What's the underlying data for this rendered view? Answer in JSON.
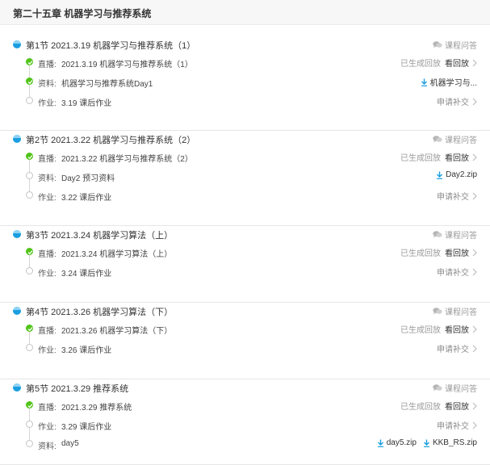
{
  "chapter_title": "第二十五章 机器学习与推荐系统",
  "colors": {
    "accent": "#1a9ee0",
    "done": "#52c41a",
    "pending": "#c4c4c4"
  },
  "icons": {
    "section": "half-filled-circle-icon",
    "qa": "chat-bubble-icon",
    "done": "check-circle-icon",
    "pending": "hollow-circle-icon",
    "download": "download-arrow-icon",
    "more": "chevron-right-icon"
  },
  "sections": [
    {
      "title": "第1节  2021.3.19 机器学习与推荐系统（1）",
      "qa_label": "课程问答",
      "items": [
        {
          "label": "直播:",
          "text": "2021.3.19 机器学习与推荐系统（1）",
          "done": true,
          "status": "已生成回放",
          "action": "看回放"
        },
        {
          "label": "资料:",
          "text": "机器学习与推荐系统Day1",
          "done": true,
          "downloads": [
            "机器学习与..."
          ]
        },
        {
          "label": "作业:",
          "text": "3.19 课后作业",
          "done": false,
          "action": "申请补交"
        }
      ]
    },
    {
      "title": "第2节  2021.3.22 机器学习与推荐系统（2）",
      "qa_label": "课程问答",
      "items": [
        {
          "label": "直播:",
          "text": "2021.3.22 机器学习与推荐系统（2）",
          "done": true,
          "status": "已生成回放",
          "action": "看回放"
        },
        {
          "label": "资料:",
          "text": "Day2 预习资料",
          "done": false,
          "downloads": [
            "Day2.zip"
          ]
        },
        {
          "label": "作业:",
          "text": "3.22 课后作业",
          "done": false,
          "action": "申请补交"
        }
      ]
    },
    {
      "title": "第3节  2021.3.24 机器学习算法（上）",
      "qa_label": "课程问答",
      "items": [
        {
          "label": "直播:",
          "text": "2021.3.24 机器学习算法（上）",
          "done": true,
          "status": "已生成回放",
          "action": "看回放"
        },
        {
          "label": "作业:",
          "text": "3.24 课后作业",
          "done": false,
          "action": "申请补交"
        }
      ]
    },
    {
      "title": "第4节  2021.3.26 机器学习算法（下）",
      "qa_label": "课程问答",
      "items": [
        {
          "label": "直播:",
          "text": "2021.3.26 机器学习算法（下）",
          "done": true,
          "status": "已生成回放",
          "action": "看回放"
        },
        {
          "label": "作业:",
          "text": "3.26 课后作业",
          "done": false,
          "action": "申请补交"
        }
      ]
    },
    {
      "title": "第5节  2021.3.29 推荐系统",
      "qa_label": "课程问答",
      "items": [
        {
          "label": "直播:",
          "text": "2021.3.29 推荐系统",
          "done": true,
          "status": "已生成回放",
          "action": "看回放"
        },
        {
          "label": "作业:",
          "text": "3.29 课后作业",
          "done": false,
          "action": "申请补交"
        },
        {
          "label": "资料:",
          "text": "day5",
          "done": false,
          "downloads": [
            "day5.zip",
            "KKB_RS.zip"
          ]
        }
      ]
    }
  ]
}
